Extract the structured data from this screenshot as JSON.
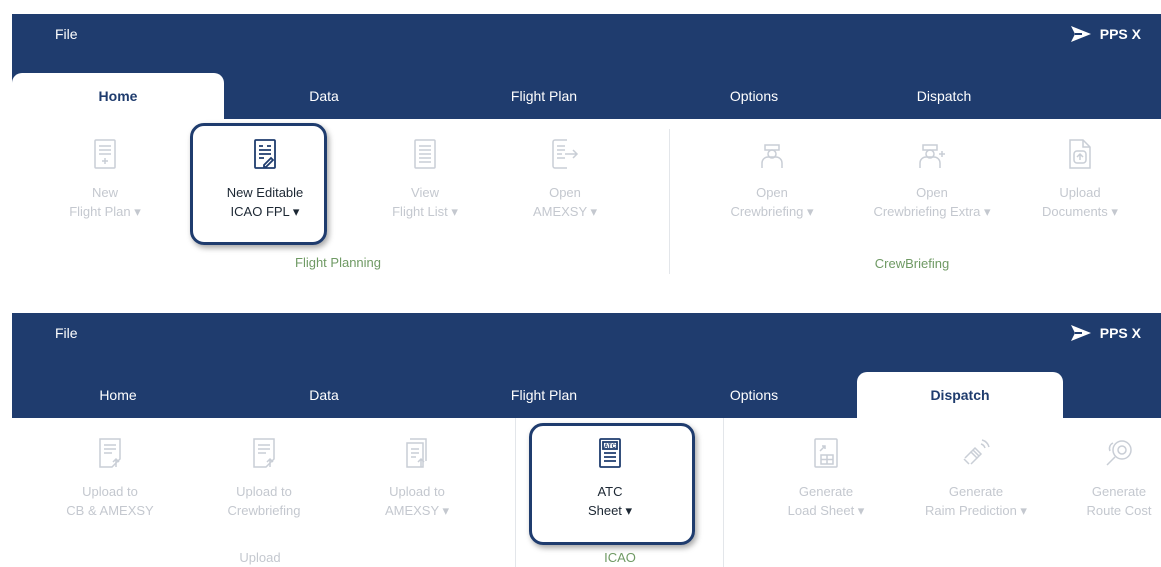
{
  "brand": {
    "name": "PPS X",
    "icon": "paper-plane-icon"
  },
  "colors": {
    "primary": "#1f3c6e",
    "group_label": "#6f9a64",
    "disabled": "#c4c8cf"
  },
  "panel1": {
    "file_label": "File",
    "tabs": [
      "Home",
      "Data",
      "Flight Plan",
      "Options",
      "Dispatch"
    ],
    "active_tab": "Home",
    "buttons": [
      {
        "line1": "New",
        "line2": "Flight Plan ▾",
        "enabled": false,
        "icon": "new-flight-plan-icon"
      },
      {
        "line1": "New Editable",
        "line2": "ICAO FPL ▾",
        "enabled": true,
        "icon": "editable-icao-fpl-icon"
      },
      {
        "line1": "View",
        "line2": "Flight List ▾",
        "enabled": false,
        "icon": "flight-list-icon"
      },
      {
        "line1": "Open",
        "line2": "AMEXSY ▾",
        "enabled": false,
        "icon": "open-amexsy-icon"
      },
      {
        "line1": "Open",
        "line2": "Crewbriefing ▾",
        "enabled": false,
        "icon": "crew-member-icon"
      },
      {
        "line1": "Open",
        "line2": "Crewbriefing Extra ▾",
        "enabled": false,
        "icon": "crew-member-add-icon"
      },
      {
        "line1": "Upload",
        "line2": "Documents ▾",
        "enabled": false,
        "icon": "upload-document-icon"
      }
    ],
    "groups": [
      "Flight Planning",
      "CrewBriefing"
    ]
  },
  "panel2": {
    "file_label": "File",
    "tabs": [
      "Home",
      "Data",
      "Flight Plan",
      "Options",
      "Dispatch"
    ],
    "active_tab": "Dispatch",
    "buttons": [
      {
        "line1": "Upload to",
        "line2": "CB & AMEXSY",
        "enabled": false,
        "icon": "upload-cb-amexsy-icon"
      },
      {
        "line1": "Upload to",
        "line2": "Crewbriefing",
        "enabled": false,
        "icon": "upload-crewbriefing-icon"
      },
      {
        "line1": "Upload to",
        "line2": "AMEXSY ▾",
        "enabled": false,
        "icon": "upload-amexsy-icon"
      },
      {
        "line1": "ATC",
        "line2": "Sheet ▾",
        "enabled": true,
        "icon": "atc-sheet-icon"
      },
      {
        "line1": "Generate",
        "line2": "Load Sheet ▾",
        "enabled": false,
        "icon": "load-sheet-icon"
      },
      {
        "line1": "Generate",
        "line2": "Raim Prediction ▾",
        "enabled": false,
        "icon": "satellite-icon"
      },
      {
        "line1": "Generate",
        "line2": "Route Cost",
        "enabled": false,
        "icon": "route-cost-icon"
      }
    ],
    "groups": [
      "Upload",
      "ICAO"
    ]
  }
}
